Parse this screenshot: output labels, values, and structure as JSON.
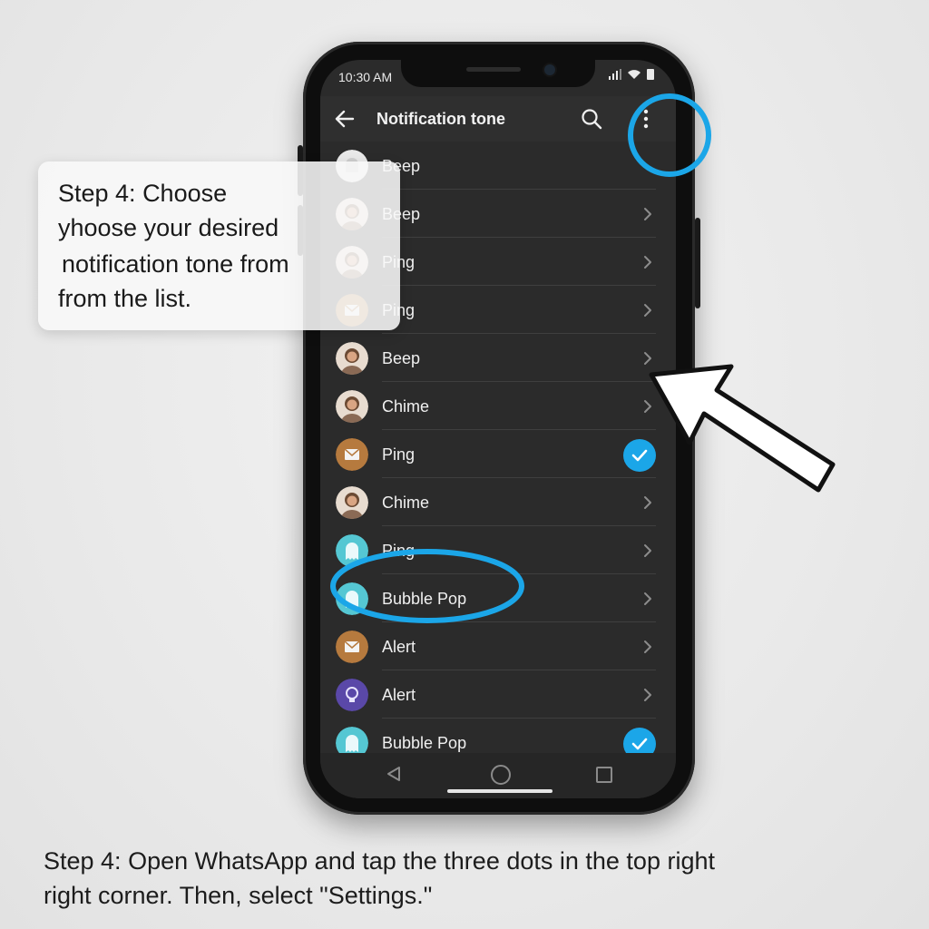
{
  "status_bar": {
    "time": "10:30 AM"
  },
  "app_bar": {
    "title": "Notification tone",
    "back_icon": "arrow-left-icon",
    "search_icon": "search-icon",
    "menu_icon": "more-vertical-icon"
  },
  "tones": [
    {
      "label": "Beep",
      "avatar": "bell-avatar",
      "trailing": "none"
    },
    {
      "label": "Beep",
      "avatar": "person-avatar",
      "trailing": "chevron"
    },
    {
      "label": "Ping",
      "avatar": "person-avatar",
      "trailing": "chevron"
    },
    {
      "label": "Ping",
      "avatar": "envelope-avatar",
      "trailing": "chevron"
    },
    {
      "label": "Beep",
      "avatar": "person-avatar",
      "trailing": "chevron"
    },
    {
      "label": "Chime",
      "avatar": "person-avatar",
      "trailing": "chevron"
    },
    {
      "label": "Ping",
      "avatar": "envelope-avatar",
      "trailing": "check"
    },
    {
      "label": "Chime",
      "avatar": "person-avatar",
      "trailing": "chevron"
    },
    {
      "label": "Ping",
      "avatar": "ghost-avatar",
      "trailing": "chevron"
    },
    {
      "label": "Bubble Pop",
      "avatar": "ghost-avatar",
      "trailing": "chevron"
    },
    {
      "label": "Alert",
      "avatar": "envelope-avatar",
      "trailing": "chevron"
    },
    {
      "label": "Alert",
      "avatar": "lightbulb-avatar",
      "trailing": "chevron"
    },
    {
      "label": "Bubble Pop",
      "avatar": "ghost-avatar",
      "trailing": "check"
    }
  ],
  "callout": {
    "line1": "Step 4: Choose",
    "line2": "yhoose your desired",
    "line3": "notification tone from",
    "line4": "from the list."
  },
  "caption": {
    "line1": "Step 4: Open WhatsApp and tap the three dots in the top right",
    "line2": "right corner. Then, select \"Settings.\""
  },
  "colors": {
    "highlight": "#1ba6e8",
    "screen_bg": "#2b2b2b",
    "check_bg": "#1ba6e8"
  }
}
